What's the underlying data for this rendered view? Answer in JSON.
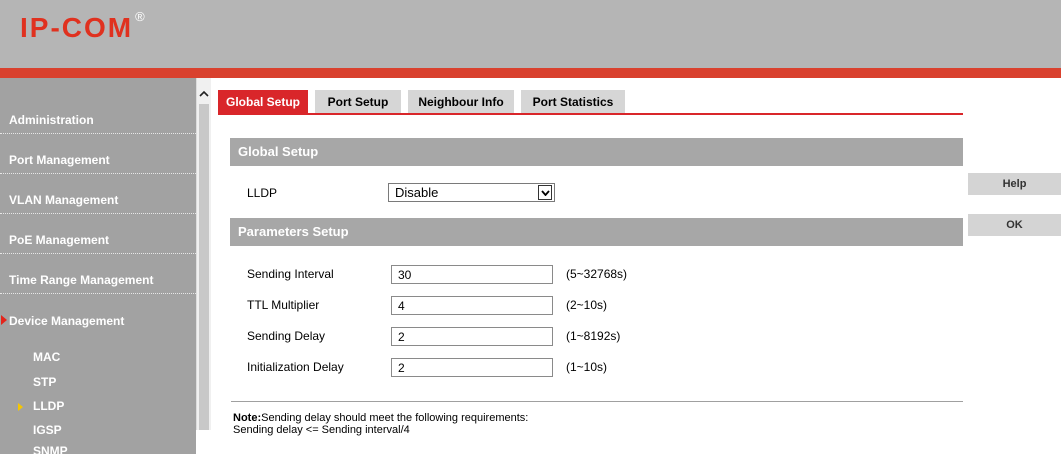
{
  "header": {
    "logo_text": "IP-COM",
    "logo_mark": "®"
  },
  "sidebar": {
    "items": [
      {
        "label": "Administration"
      },
      {
        "label": "Port Management"
      },
      {
        "label": "VLAN Management"
      },
      {
        "label": "PoE Management"
      },
      {
        "label": "Time Range Management"
      },
      {
        "label": "Device Management",
        "expanded": true
      }
    ],
    "sub_items": [
      {
        "label": "MAC"
      },
      {
        "label": "STP"
      },
      {
        "label": "LLDP",
        "selected": true
      },
      {
        "label": "IGSP"
      },
      {
        "label": "SNMP"
      }
    ]
  },
  "tabs": [
    {
      "label": "Global Setup",
      "active": true
    },
    {
      "label": "Port Setup"
    },
    {
      "label": "Neighbour Info"
    },
    {
      "label": "Port Statistics"
    }
  ],
  "global_setup": {
    "heading": "Global Setup",
    "lldp_label": "LLDP",
    "lldp_value": "Disable"
  },
  "parameters": {
    "heading": "Parameters Setup",
    "rows": [
      {
        "label": "Sending Interval",
        "value": "30",
        "range": "(5~32768s)"
      },
      {
        "label": "TTL Multiplier",
        "value": "4",
        "range": "(2~10s)"
      },
      {
        "label": "Sending Delay",
        "value": "2",
        "range": "(1~8192s)"
      },
      {
        "label": "Initialization Delay",
        "value": "2",
        "range": "(1~10s)"
      }
    ]
  },
  "note": {
    "title": "Note:",
    "line1": "Sending delay should meet the following requirements:",
    "line2": "Sending delay <= Sending interval/4"
  },
  "buttons": {
    "help": "Help",
    "ok": "OK"
  },
  "colors": {
    "accent_red": "#d9262a",
    "header_gray": "#b5b5b5",
    "sidebar_gray": "#a2a2a2"
  }
}
